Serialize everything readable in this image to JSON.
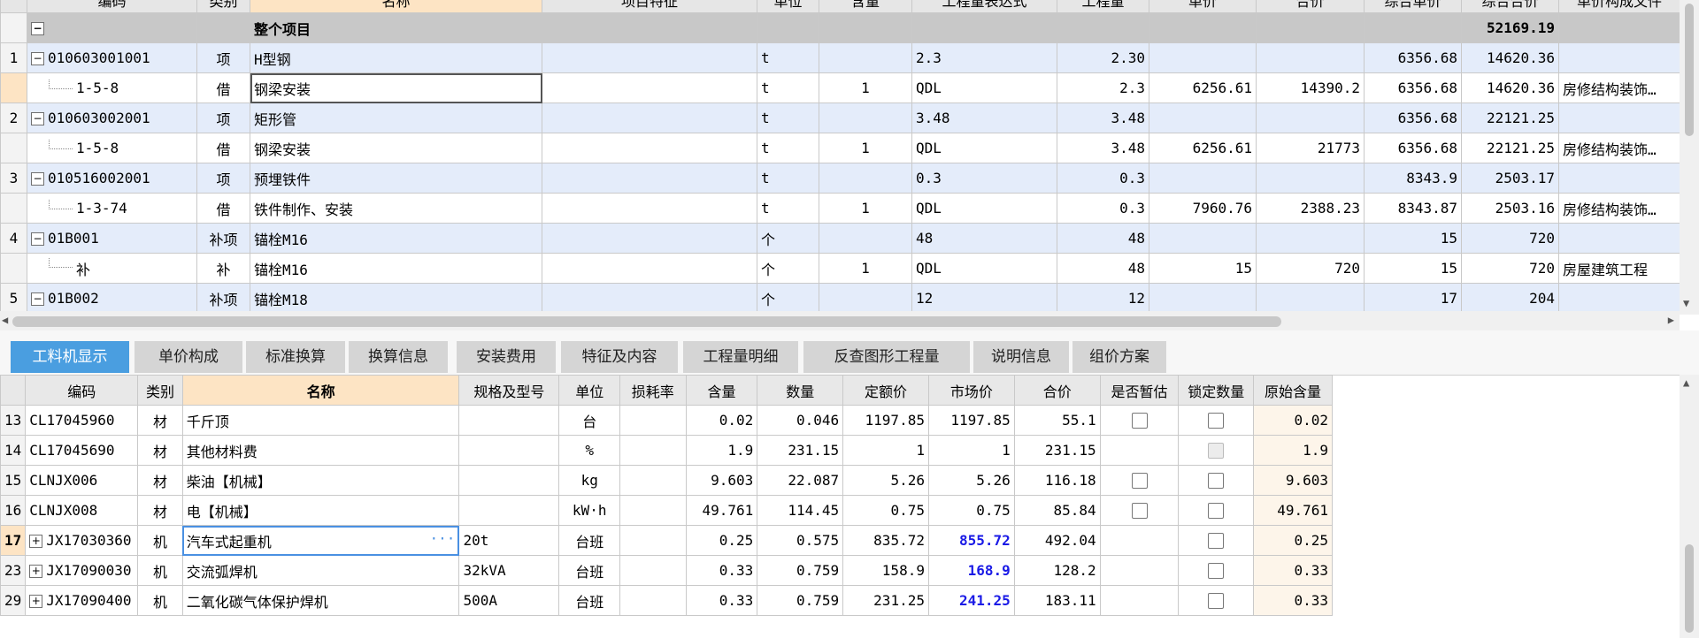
{
  "upper_grid": {
    "headers": [
      "",
      "编码",
      "类别",
      "名称",
      "项目特征",
      "单位",
      "含量",
      "工程量表达式",
      "工程量",
      "单价",
      "合价",
      "综合单价",
      "综合合价",
      "单价构成文件"
    ],
    "total_row": {
      "label": "整个项目",
      "total": "52169.19"
    },
    "rows": [
      {
        "num": "1",
        "kind": "item",
        "expander": "−",
        "code": "010603001001",
        "type": "项",
        "name": "H型钢",
        "feature": "",
        "unit": "t",
        "content": "",
        "expr": "2.3",
        "qty": "2.30",
        "price": "",
        "amount": "",
        "unit_total": "6356.68",
        "total": "14620.36",
        "file": ""
      },
      {
        "num": "",
        "kind": "sub",
        "expander": "",
        "code": "1-5-8",
        "type": "借",
        "name": "钢梁安装",
        "feature": "",
        "unit": "t",
        "content": "1",
        "expr": "QDL",
        "qty": "2.3",
        "price": "6256.61",
        "amount": "14390.2",
        "unit_total": "6356.68",
        "total": "14620.36",
        "file": "房修结构装饰…"
      },
      {
        "num": "2",
        "kind": "item",
        "expander": "−",
        "code": "010603002001",
        "type": "项",
        "name": "矩形管",
        "feature": "",
        "unit": "t",
        "content": "",
        "expr": "3.48",
        "qty": "3.48",
        "price": "",
        "amount": "",
        "unit_total": "6356.68",
        "total": "22121.25",
        "file": ""
      },
      {
        "num": "",
        "kind": "sub",
        "expander": "",
        "code": "1-5-8",
        "type": "借",
        "name": "钢梁安装",
        "feature": "",
        "unit": "t",
        "content": "1",
        "expr": "QDL",
        "qty": "3.48",
        "price": "6256.61",
        "amount": "21773",
        "unit_total": "6356.68",
        "total": "22121.25",
        "file": "房修结构装饰…"
      },
      {
        "num": "3",
        "kind": "item",
        "expander": "−",
        "code": "010516002001",
        "type": "项",
        "name": "预埋铁件",
        "feature": "",
        "unit": "t",
        "content": "",
        "expr": "0.3",
        "qty": "0.3",
        "price": "",
        "amount": "",
        "unit_total": "8343.9",
        "total": "2503.17",
        "file": ""
      },
      {
        "num": "",
        "kind": "sub",
        "expander": "",
        "code": "1-3-74",
        "type": "借",
        "name": "铁件制作、安装",
        "feature": "",
        "unit": "t",
        "content": "1",
        "expr": "QDL",
        "qty": "0.3",
        "price": "7960.76",
        "amount": "2388.23",
        "unit_total": "8343.87",
        "total": "2503.16",
        "file": "房修结构装饰…"
      },
      {
        "num": "4",
        "kind": "item",
        "expander": "−",
        "code": "01B001",
        "type": "补项",
        "name": "锚栓M16",
        "feature": "",
        "unit": "个",
        "content": "",
        "expr": "48",
        "qty": "48",
        "price": "",
        "amount": "",
        "unit_total": "15",
        "total": "720",
        "file": ""
      },
      {
        "num": "",
        "kind": "sub",
        "expander": "",
        "code": "补",
        "type": "补",
        "name": "锚栓M16",
        "feature": "",
        "unit": "个",
        "content": "1",
        "expr": "QDL",
        "qty": "48",
        "price": "15",
        "amount": "720",
        "unit_total": "15",
        "total": "720",
        "file": "房屋建筑工程"
      },
      {
        "num": "5",
        "kind": "item",
        "expander": "−",
        "code": "01B002",
        "type": "补项",
        "name": "锚栓M18",
        "feature": "",
        "unit": "个",
        "content": "",
        "expr": "12",
        "qty": "12",
        "price": "",
        "amount": "",
        "unit_total": "17",
        "total": "204",
        "file": ""
      }
    ]
  },
  "tabs": [
    "工料机显示",
    "单价构成",
    "标准换算",
    "换算信息",
    "安装费用",
    "特征及内容",
    "工程量明细",
    "反查图形工程量",
    "说明信息",
    "组价方案"
  ],
  "lower_grid": {
    "headers": [
      "",
      "编码",
      "类别",
      "名称",
      "规格及型号",
      "单位",
      "损耗率",
      "含量",
      "数量",
      "定额价",
      "市场价",
      "合价",
      "是否暂估",
      "锁定数量",
      "原始含量"
    ],
    "rows": [
      {
        "num": "13",
        "expander": "",
        "code": "CL17045960",
        "type": "材",
        "name": "千斤顶",
        "spec": "",
        "unit": "台",
        "loss": "",
        "content": "0.02",
        "qty": "0.046",
        "quota": "1197.85",
        "market": "1197.85",
        "total": "55.1",
        "est": "box",
        "lock": "box",
        "orig": "0.02"
      },
      {
        "num": "14",
        "expander": "",
        "code": "CL17045690",
        "type": "材",
        "name": "其他材料费",
        "spec": "",
        "unit": "%",
        "loss": "",
        "content": "1.9",
        "qty": "231.15",
        "quota": "1",
        "market": "1",
        "total": "231.15",
        "est": "",
        "lock": "disabled",
        "orig": "1.9"
      },
      {
        "num": "15",
        "expander": "",
        "code": "CLNJX006",
        "type": "材",
        "name": "柴油【机械】",
        "spec": "",
        "unit": "kg",
        "loss": "",
        "content": "9.603",
        "qty": "22.087",
        "quota": "5.26",
        "market": "5.26",
        "total": "116.18",
        "est": "box",
        "lock": "box",
        "orig": "9.603"
      },
      {
        "num": "16",
        "expander": "",
        "code": "CLNJX008",
        "type": "材",
        "name": "电【机械】",
        "spec": "",
        "unit": "kW·h",
        "loss": "",
        "content": "49.761",
        "qty": "114.45",
        "quota": "0.75",
        "market": "0.75",
        "total": "85.84",
        "est": "box",
        "lock": "box",
        "orig": "49.761"
      },
      {
        "num": "17",
        "expander": "+",
        "code": "JX17030360",
        "type": "机",
        "name": "汽车式起重机",
        "spec": "20t",
        "unit": "台班",
        "loss": "",
        "content": "0.25",
        "qty": "0.575",
        "quota": "835.72",
        "market": "855.72",
        "total": "492.04",
        "est": "",
        "lock": "box",
        "orig": "0.25"
      },
      {
        "num": "23",
        "expander": "+",
        "code": "JX17090030",
        "type": "机",
        "name": "交流弧焊机",
        "spec": "32kVA",
        "unit": "台班",
        "loss": "",
        "content": "0.33",
        "qty": "0.759",
        "quota": "158.9",
        "market": "168.9",
        "total": "128.2",
        "est": "",
        "lock": "box",
        "orig": "0.33"
      },
      {
        "num": "29",
        "expander": "+",
        "code": "JX17090400",
        "type": "机",
        "name": "二氧化碳气体保护焊机",
        "spec": "500A",
        "unit": "台班",
        "loss": "",
        "content": "0.33",
        "qty": "0.759",
        "quota": "231.25",
        "market": "241.25",
        "total": "183.11",
        "est": "",
        "lock": "box",
        "orig": "0.33"
      }
    ]
  }
}
